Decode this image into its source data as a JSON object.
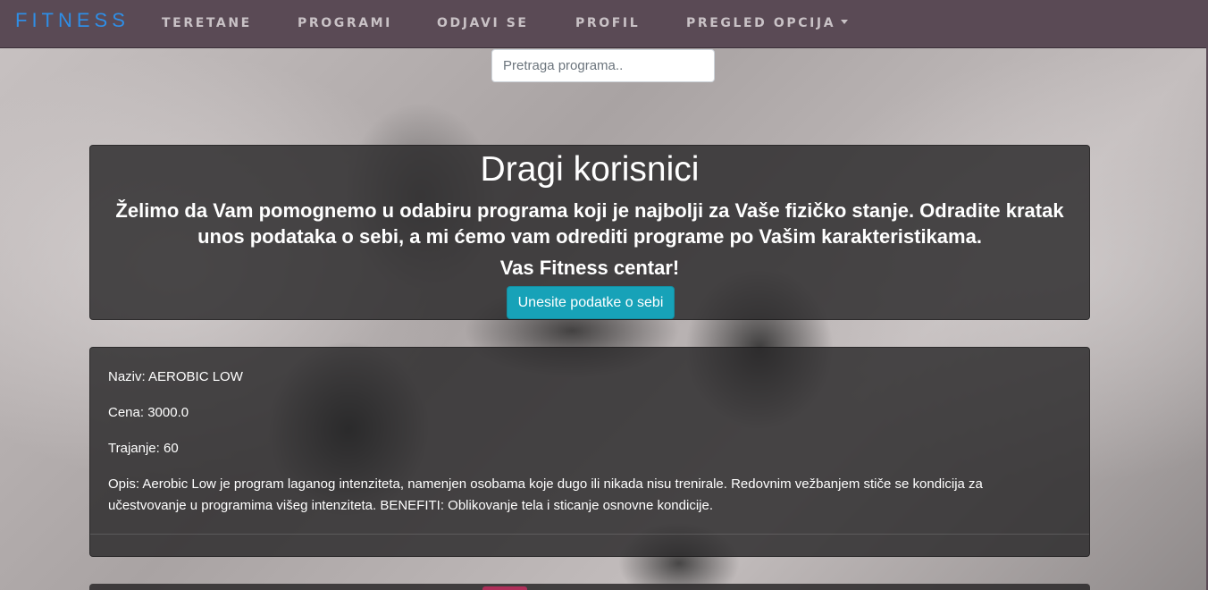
{
  "navbar": {
    "brand": "FITNESS",
    "items": [
      {
        "label": "TERETANE"
      },
      {
        "label": "PROGRAMI"
      },
      {
        "label": "ODJAVI SE"
      },
      {
        "label": "PROFIL"
      },
      {
        "label": "PREGLED OPCIJA"
      }
    ]
  },
  "search": {
    "placeholder": "Pretraga programa.."
  },
  "hero": {
    "title": "Dragi korisnici",
    "text": "Želimo da Vam pomognemo u odabiru programa koji je najbolji za Vaše fizičko stanje. Odradite kratak unos podataka o sebi, a mi ćemo vam odrediti programe po Vašim karakteristikama.",
    "signature": "Vas Fitness centar!",
    "button_label": "Unesite podatke o sebi"
  },
  "program": {
    "naziv": "Naziv: AEROBIC LOW",
    "cena": "Cena: 3000.0",
    "trajanje": "Trajanje: 60",
    "opis": "Opis: Aerobic Low je program laganog intenziteta, namenjen osobama koje dugo ili nikada nisu trenirale. Redovnim vežbanjem stiče se kondicija za učestvovanje u programima višeg intenziteta. BENEFITI: Oblikovanje tela i sticanje osnovne kondicije."
  },
  "colors": {
    "navbar": "#5a4a55",
    "brand": "#2f8ee6",
    "button": "#17a2b8"
  }
}
